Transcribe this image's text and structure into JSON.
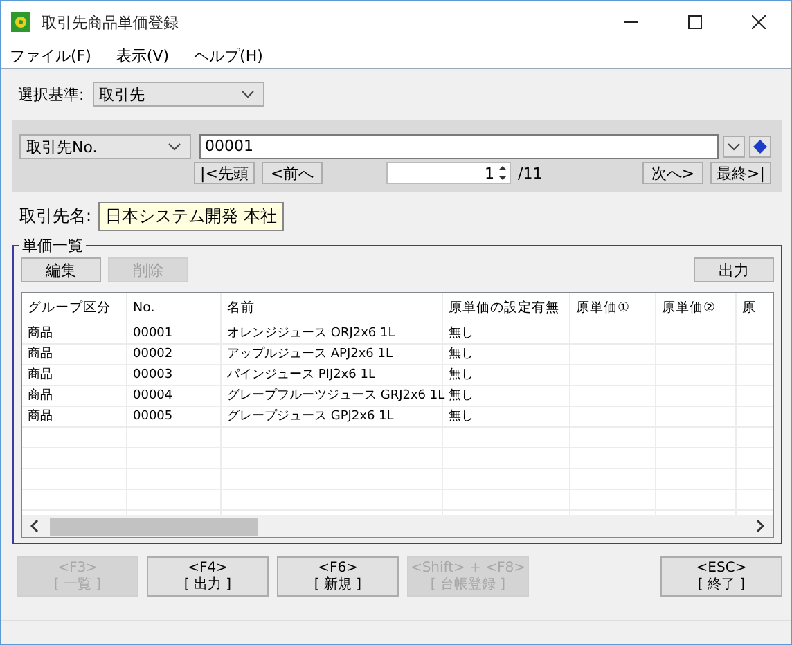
{
  "window": {
    "title": "取引先商品単価登録"
  },
  "menu": [
    "ファイル(F)",
    "表示(V)",
    "ヘルプ(H)"
  ],
  "criteria": {
    "label": "選択基準:",
    "value": "取引先"
  },
  "search": {
    "key": "取引先No.",
    "value": "00001",
    "page": "1",
    "total": "/11",
    "nav_left": [
      "|<先頭",
      "<前へ"
    ],
    "nav_right": [
      "次へ>",
      "最終>|"
    ]
  },
  "partner": {
    "label": "取引先名:",
    "value": "日本システム開発 本社"
  },
  "group": {
    "title": "単価一覧",
    "actions": [
      {
        "label": "編集",
        "disabled": false
      },
      {
        "label": "削除",
        "disabled": true
      }
    ],
    "export_button": {
      "label": "出力",
      "disabled": false
    },
    "table": {
      "columns": [
        "グループ区分",
        "No.",
        "名前",
        "原単価の設定有無",
        "原単価①",
        "原単価②",
        "原"
      ],
      "rows": [
        [
          "商品",
          "00001",
          "オレンジジュース ORJ2x6 1L",
          "無し"
        ],
        [
          "商品",
          "00002",
          "アップルジュース APJ2x6 1L",
          "無し"
        ],
        [
          "商品",
          "00003",
          "パインジュース PIJ2x6 1L",
          "無し"
        ],
        [
          "商品",
          "00004",
          "グレープフルーツジュース GRJ2x6 1L",
          "無し"
        ],
        [
          "商品",
          "00005",
          "グレープジュース GPJ2x6 1L",
          "無し"
        ]
      ]
    }
  },
  "function_keys": [
    {
      "key": "<F3>",
      "label": "[ 一覧 ]",
      "disabled": true
    },
    {
      "key": "<F4>",
      "label": "[ 出力 ]",
      "disabled": false
    },
    {
      "key": "<F6>",
      "label": "[ 新規 ]",
      "disabled": false
    },
    {
      "key": "<Shift> + <F8>",
      "label": "[ 台帳登録 ]",
      "disabled": true
    },
    {
      "key": "<ESC>",
      "label": "[ 終了 ]",
      "disabled": false
    }
  ]
}
